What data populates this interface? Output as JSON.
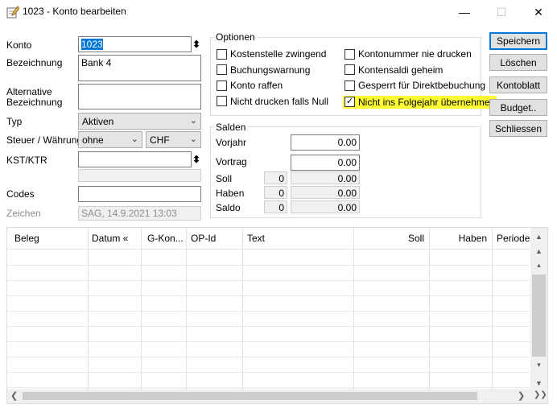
{
  "window": {
    "title": "1023 - Konto bearbeiten",
    "minimize_glyph": "—",
    "maximize_glyph": "☐",
    "close_glyph": "✕"
  },
  "form": {
    "konto_label": "Konto",
    "konto_value": "1023",
    "bezeichnung_label": "Bezeichnung",
    "bezeichnung_value": "Bank 4",
    "alt_label_1": "Alternative",
    "alt_label_2": "Bezeichnung",
    "alt_value": "",
    "typ_label": "Typ",
    "typ_value": "Aktiven",
    "steuer_label": "Steuer / Währung",
    "steuer_value": "ohne",
    "waehrung_value": "CHF",
    "kst_label": "KST/KTR",
    "kst_value": "",
    "codes_label": "Codes",
    "codes_value": "",
    "zeichen_label": "Zeichen",
    "zeichen_value": "SAG,  14.9.2021  13:03"
  },
  "optionen": {
    "title": "Optionen",
    "left": [
      {
        "label": "Kostenstelle zwingend",
        "checked": false
      },
      {
        "label": "Buchungswarnung",
        "checked": false
      },
      {
        "label": "Konto raffen",
        "checked": false
      },
      {
        "label": "Nicht drucken falls Null",
        "checked": false
      }
    ],
    "right": [
      {
        "label": "Kontonummer nie drucken",
        "checked": false
      },
      {
        "label": "Kontensaldi geheim",
        "checked": false
      },
      {
        "label": "Gesperrt für Direktbebuchung",
        "checked": false
      },
      {
        "label": "Nicht ins Folgejahr übernehmen",
        "checked": true
      }
    ],
    "highlight_color": "#ffff33"
  },
  "salden": {
    "title": "Salden",
    "vorjahr_label": "Vorjahr",
    "vorjahr_value": "0.00",
    "vortrag_label": "Vortrag",
    "vortrag_value": "0.00",
    "soll_label": "Soll",
    "soll_count": "0",
    "soll_value": "0.00",
    "haben_label": "Haben",
    "haben_count": "0",
    "haben_value": "0.00",
    "saldo_label": "Saldo",
    "saldo_count": "0",
    "saldo_value": "0.00"
  },
  "buttons": {
    "speichern": "Speichern",
    "loeschen": "Löschen",
    "kontoblatt": "Kontoblatt",
    "budget": "Budget..",
    "schliessen": "Schliessen"
  },
  "grid": {
    "columns": [
      "Beleg",
      "Datum «",
      "G-Kon...",
      "OP-Id",
      "Text",
      "Soll",
      "Haben",
      "Periode"
    ]
  }
}
